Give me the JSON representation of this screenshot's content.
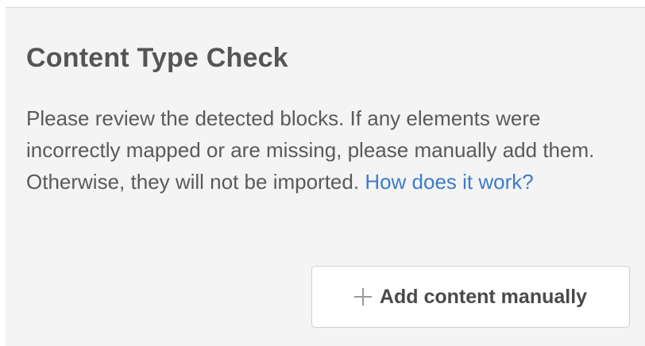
{
  "panel": {
    "title": "Content Type Check",
    "description": "Please review the detected blocks. If any elements were incorrectly mapped or are missing, please manually add them. Otherwise, they will not be imported.",
    "help_link": "How does it work?",
    "add_button": {
      "label": "Add content manually",
      "icon": "plus-icon"
    }
  }
}
